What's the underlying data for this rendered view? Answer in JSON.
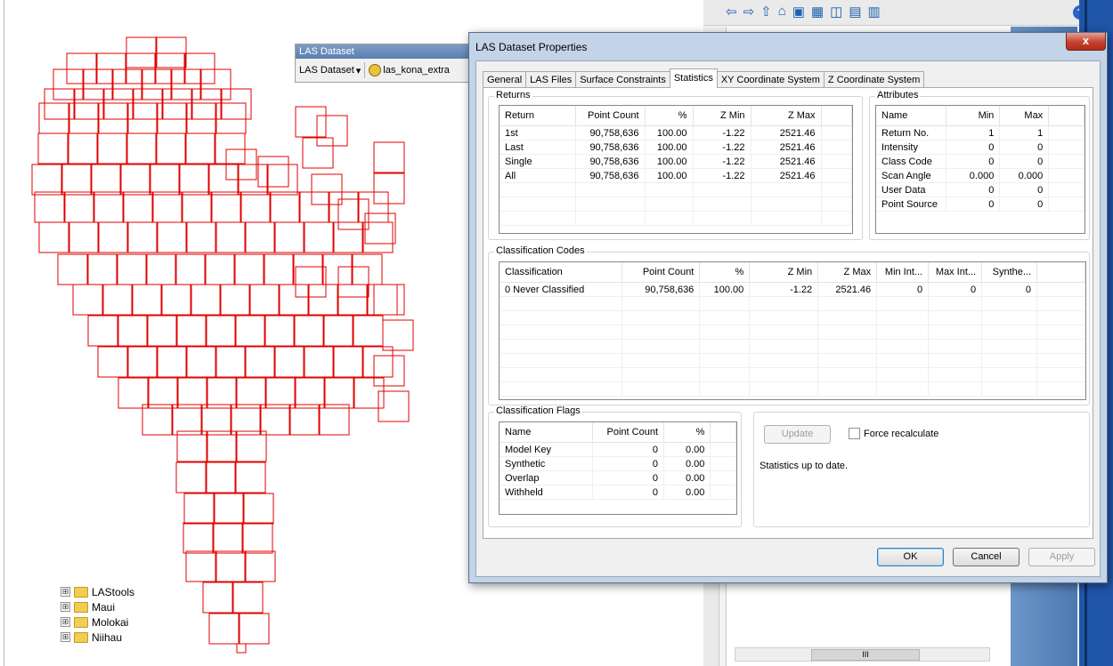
{
  "toolbar": {
    "title": "LAS Dataset",
    "dropdown_label": "LAS Dataset",
    "dropdown_arrow": "▾",
    "layer_name": "las_kona_extra"
  },
  "background_app": {
    "tree_items": [
      {
        "label": "LAStools",
        "expander": "⊞"
      },
      {
        "label": "Maui",
        "expander": "⊞"
      },
      {
        "label": "Molokai",
        "expander": "⊞"
      },
      {
        "label": "Niihau",
        "expander": "⊞"
      }
    ],
    "scroll_thumb_text": "III",
    "toolbar_icons": [
      "back-arrow-icon",
      "forward-arrow-icon",
      "up-folder-icon",
      "home-folder-icon",
      "connect-folder-icon",
      "view-options-icon",
      "new-item-icon",
      "metadata-icon",
      "options-icon"
    ],
    "help_label": "?"
  },
  "dialog": {
    "title": "LAS Dataset Properties",
    "close_label": "x",
    "tabs": [
      {
        "label": "General",
        "active": false
      },
      {
        "label": "LAS Files",
        "active": false
      },
      {
        "label": "Surface Constraints",
        "active": false
      },
      {
        "label": "Statistics",
        "active": true
      },
      {
        "label": "XY Coordinate System",
        "active": false
      },
      {
        "label": "Z Coordinate System",
        "active": false
      }
    ],
    "returns": {
      "label": "Returns",
      "headers": [
        "Return",
        "Point Count",
        "%",
        "Z Min",
        "Z Max",
        ""
      ],
      "rows": [
        [
          "1st",
          "90,758,636",
          "100.00",
          "-1.22",
          "2521.46",
          ""
        ],
        [
          "Last",
          "90,758,636",
          "100.00",
          "-1.22",
          "2521.46",
          ""
        ],
        [
          "Single",
          "90,758,636",
          "100.00",
          "-1.22",
          "2521.46",
          ""
        ],
        [
          "All",
          "90,758,636",
          "100.00",
          "-1.22",
          "2521.46",
          ""
        ]
      ]
    },
    "attributes": {
      "label": "Attributes",
      "headers": [
        "Name",
        "Min",
        "Max",
        ""
      ],
      "rows": [
        [
          "Return No.",
          "1",
          "1",
          ""
        ],
        [
          "Intensity",
          "0",
          "0",
          ""
        ],
        [
          "Class Code",
          "0",
          "0",
          ""
        ],
        [
          "Scan Angle",
          "0.000",
          "0.000",
          ""
        ],
        [
          "User Data",
          "0",
          "0",
          ""
        ],
        [
          "Point Source",
          "0",
          "0",
          ""
        ]
      ]
    },
    "classification_codes": {
      "label": "Classification Codes",
      "headers": [
        "Classification",
        "Point Count",
        "%",
        "Z Min",
        "Z Max",
        "Min Int...",
        "Max Int...",
        "Synthe...",
        ""
      ],
      "rows": [
        [
          "0  Never Classified",
          "90,758,636",
          "100.00",
          "-1.22",
          "2521.46",
          "0",
          "0",
          "0",
          ""
        ]
      ]
    },
    "classification_flags": {
      "label": "Classification Flags",
      "headers": [
        "Name",
        "Point Count",
        "%",
        ""
      ],
      "rows": [
        [
          "Model Key",
          "0",
          "0.00",
          ""
        ],
        [
          "Synthetic",
          "0",
          "0.00",
          ""
        ],
        [
          "Overlap",
          "0",
          "0.00",
          ""
        ],
        [
          "Withheld",
          "0",
          "0.00",
          ""
        ]
      ]
    },
    "update_button": "Update",
    "force_recalculate": "Force recalculate",
    "status_text": "Statistics up to date.",
    "ok_button": "OK",
    "cancel_button": "Cancel",
    "apply_button": "Apply"
  },
  "colors": {
    "tile_outline": "#e00000",
    "title_bar": "#c3d3e8",
    "close_button": "#c4422f"
  }
}
